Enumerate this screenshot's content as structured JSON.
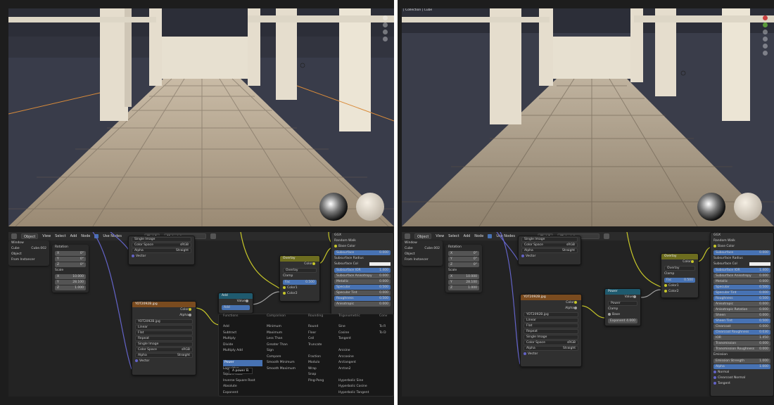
{
  "left": {
    "header": {
      "mode": "Object",
      "view": "View",
      "select": "Select",
      "add": "Add",
      "node": "Node",
      "use_nodes": "Use Nodes",
      "slot": "Slot 1",
      "material": "Material"
    },
    "props": {
      "win": "Window",
      "cube": "Cube",
      "cube2": "Cube.002",
      "obj": "Object",
      "inst": "From Instancer",
      "rot": "Rotation",
      "rx": "0°",
      "ry": "0°",
      "rz": "0°",
      "scale": "Scale",
      "sx": "10.000",
      "sy": "28.100",
      "sz": "1.000",
      "x": "X",
      "y": "Y",
      "z": "Z"
    },
    "img": {
      "title": "Single Image",
      "cs": "Color Space",
      "csv": "sRGB",
      "alpha": "Alpha",
      "alphav": "Straight",
      "vector": "Vector"
    },
    "tex": {
      "title": "YOT2092B.jpg",
      "color": "Color",
      "alpha": "Alpha",
      "file": "YOT2092B.jpg",
      "interp": "Linear",
      "proj": "Flat",
      "ext": "Repeat",
      "src": "Single Image",
      "cs": "Color Space",
      "csv": "sRGB",
      "al": "Alpha",
      "alv": "Straight",
      "vector": "Vector"
    },
    "overlay": {
      "title": "Overlay",
      "color": "Color",
      "mode": "Overlay",
      "clamp": "Clamp",
      "fac": "Fac",
      "facv": "0.500",
      "c1": "Color1",
      "c2": "Color2"
    },
    "add": {
      "title": "Add",
      "value": "Value",
      "op": "Add"
    },
    "bsdf": {
      "rw": "Random Walk",
      "bc": "Base Color",
      "ss": "Subsurface",
      "ssv": "0.000",
      "ssr": "Subsurface Radius",
      "ssc": "Subsurface Col",
      "ior": "Subsurface IOR",
      "iorv": "1.400",
      "ani": "Subsurface Anisotropy",
      "aniv": "0.000",
      "met": "Metallic",
      "metv": "0.000",
      "spec": "Specular",
      "specv": "0.500",
      "st": "Specular Tint",
      "stv": "0.000",
      "rough": "Roughness",
      "roughv": "0.500",
      "an": "Anisotropic",
      "anv": "0.000",
      "top": "GGX"
    },
    "menu": {
      "h1": "Functions",
      "h2": "Comparison",
      "h3": "Rounding",
      "h4": "Trigonometric",
      "h5": "Conv",
      "c1": [
        "Add",
        "Subtract",
        "Multiply",
        "Divide",
        "Multiply Add",
        "",
        "Power",
        "Logarithm",
        "Square Root",
        "Inverse Square Root",
        "Absolute",
        "Exponent"
      ],
      "c2": [
        "Minimum",
        "Maximum",
        "Less Than",
        "Greater Than",
        "Sign",
        "Compare",
        "Smooth Minimum",
        "Smooth Maximum"
      ],
      "c3": [
        "Round",
        "Floor",
        "Ceil",
        "Truncate",
        "",
        "Fraction",
        "Modulo",
        "Wrap",
        "Snap",
        "Ping-Pong"
      ],
      "c4": [
        "Sine",
        "Cosine",
        "Tangent",
        "",
        "Arcsine",
        "Arccosine",
        "Arctangent",
        "Arctan2",
        "",
        "Hyperbolic Sine",
        "Hyperbolic Cosine",
        "Hyperbolic Tangent"
      ],
      "c5": [
        "To R",
        "To D"
      ],
      "tip": "A power B."
    }
  },
  "right": {
    "overlay_text": "| Collection | Cube",
    "header": {
      "mode": "Object",
      "view": "View",
      "select": "Select",
      "add": "Add",
      "node": "Node",
      "use_nodes": "Use Nodes",
      "slot": "Slot 1",
      "material": "Material"
    },
    "props": {
      "win": "Window",
      "cube": "Cube",
      "cube2": "Cube.002",
      "obj": "Object",
      "inst": "From Instancer",
      "rot": "Rotation",
      "rx": "0°",
      "ry": "0°",
      "rz": "0°",
      "scale": "Scale",
      "sx": "10.000",
      "sy": "28.100",
      "sz": "1.000",
      "x": "X",
      "y": "Y",
      "z": "Z"
    },
    "img": {
      "title": "Single Image",
      "cs": "Color Space",
      "csv": "sRGB",
      "alpha": "Alpha",
      "alphav": "Straight",
      "vector": "Vector"
    },
    "tex": {
      "title": "YOT2092B.jpg",
      "color": "Color",
      "alpha": "Alpha",
      "file": "YOT2092B.jpg",
      "interp": "Linear",
      "proj": "Flat",
      "ext": "Repeat",
      "src": "Single Image",
      "cs": "Color Space",
      "csv": "sRGB",
      "al": "Alpha",
      "alv": "Straight",
      "vector": "Vector"
    },
    "power": {
      "title": "Power",
      "value": "Value",
      "op": "Power",
      "clamp": "Clamp",
      "base": "Base",
      "exp": "Exponent",
      "expv": "4.000"
    },
    "overlay": {
      "title": "Overlay",
      "color": "Color",
      "mode": "Overlay",
      "clamp": "Clamp",
      "fac": "Fac",
      "facv": "0.500",
      "c1": "Color1",
      "c2": "Color2"
    },
    "bsdf": {
      "top": "GGX",
      "rw": "Random Walk",
      "bc": "Base Color",
      "ss": "Subsurface",
      "ssv": "0.000",
      "ssr": "Subsurface Radius",
      "ssc": "Subsurface Col",
      "rows": [
        [
          "Subsurface IOR",
          "1.400",
          "b"
        ],
        [
          "Subsurface Anisotropy",
          "0.000",
          "g"
        ],
        [
          "Metallic",
          "0.000",
          "g"
        ],
        [
          "Specular",
          "0.500",
          "b"
        ],
        [
          "Specular Tint",
          "0.000",
          "b"
        ],
        [
          "Roughness",
          "0.500",
          "b"
        ],
        [
          "Anisotropic",
          "0.000",
          "g"
        ],
        [
          "Anisotropic Rotation",
          "0.000",
          "g"
        ],
        [
          "Sheen",
          "0.000",
          "g"
        ],
        [
          "Sheen Tint",
          "0.500",
          "b"
        ],
        [
          "Clearcoat",
          "0.000",
          "g"
        ],
        [
          "Clearcoat Roughness",
          "0.030",
          "b"
        ],
        [
          "IOR",
          "1.450",
          "g"
        ],
        [
          "Transmission",
          "0.000",
          "g"
        ],
        [
          "Transmission Roughness",
          "0.000",
          "g"
        ]
      ],
      "em": "Emission",
      "es": "Emission Strength",
      "esv": "1.000",
      "alpha": "Alpha",
      "alphav": "1.000",
      "normal": "Normal",
      "cn": "Clearcoat Normal",
      "tan": "Tangent"
    }
  }
}
